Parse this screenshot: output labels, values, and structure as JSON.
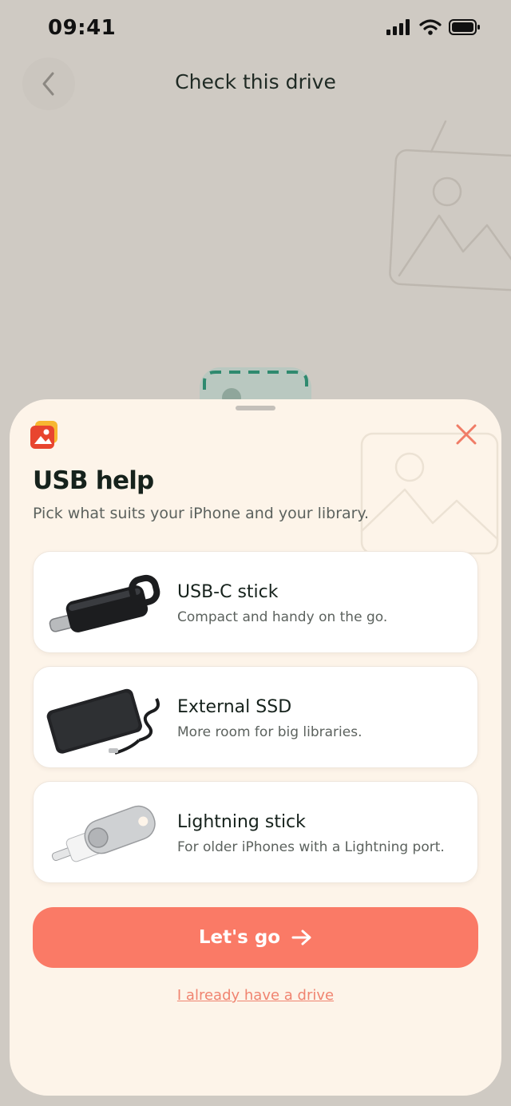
{
  "status": {
    "time": "09:41",
    "icons": [
      "signal-icon",
      "wifi-icon",
      "battery-icon"
    ]
  },
  "header": {
    "title": "Check this drive",
    "back_icon": "chevron-left-icon"
  },
  "sheet": {
    "title": "USB help",
    "subtitle": "Pick what suits your iPhone and your library.",
    "options": [
      {
        "label": "USB-C stick",
        "description": "Compact and handy on the go.",
        "image": "usb-c-stick-image"
      },
      {
        "label": "External SSD",
        "description": "More room for big libraries.",
        "image": "external-ssd-image"
      },
      {
        "label": "Lightning stick",
        "description": "For older iPhones with a Lightning port.",
        "image": "lightning-stick-image"
      }
    ],
    "primary_button": "Let's go",
    "secondary_link": "I already have a drive"
  },
  "colors": {
    "accent": "#FA7A66",
    "sheet_bg": "#FDF4E9",
    "page_bg": "#CFCAC3"
  }
}
